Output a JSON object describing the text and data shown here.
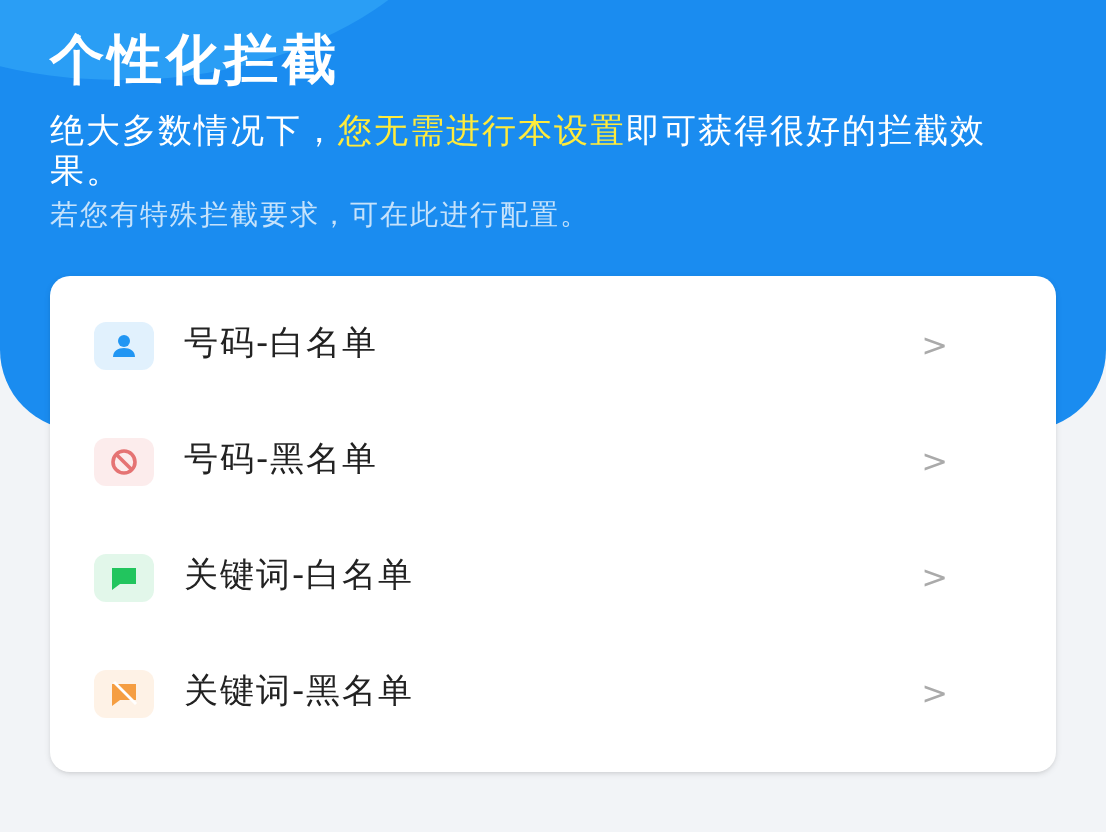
{
  "header": {
    "title": "个性化拦截",
    "description": "绝大多数情况下，**您无需进行本设置**即可获得很好的拦截效果。",
    "note": "若您有特殊拦截要求，可在此进行配置。"
  },
  "list": [
    {
      "label": "号码-白名单",
      "kind": "person",
      "color": "#2196f3",
      "chevron": ">"
    },
    {
      "label": "号码-黑名单",
      "kind": "block",
      "color": "#e57373",
      "chevron": ">"
    },
    {
      "label": "关键词-白名单",
      "kind": "chat",
      "color": "#22c55e",
      "chevron": ">"
    },
    {
      "label": "关键词-黑名单",
      "kind": "chat-off",
      "color": "#f59e42",
      "chevron": ">"
    }
  ]
}
